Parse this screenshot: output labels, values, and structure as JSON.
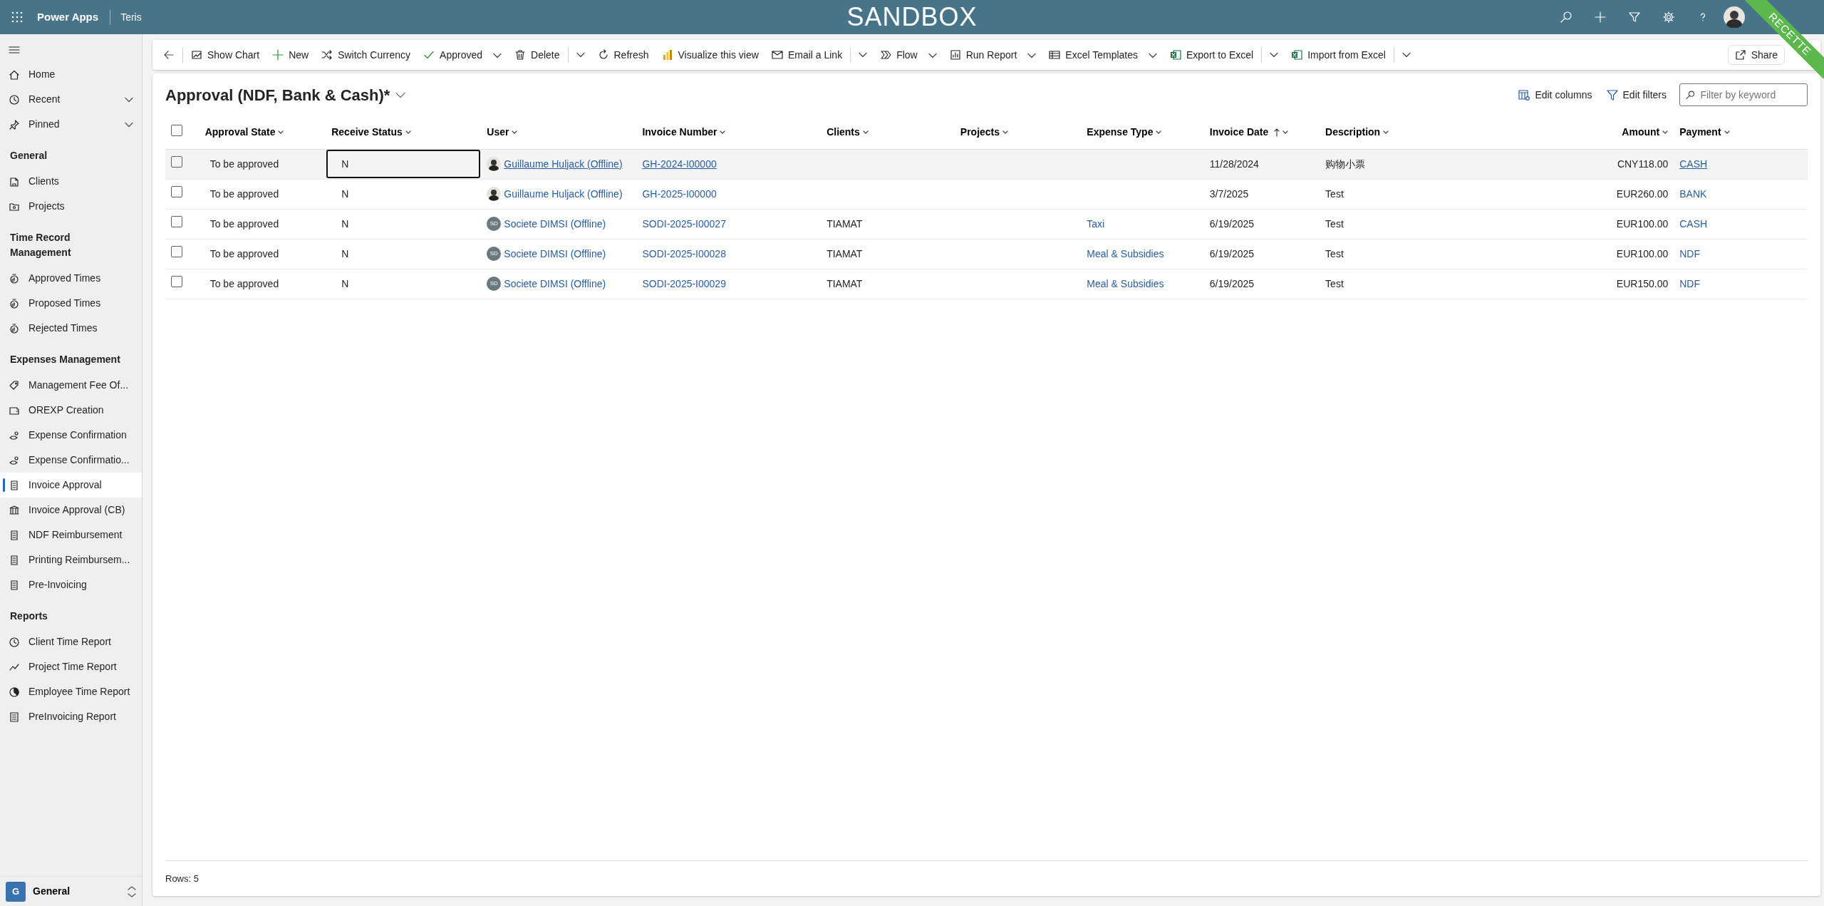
{
  "app_bar": {
    "app_name": "Power Apps",
    "environment": "Teris",
    "banner": "SANDBOX",
    "ribbon": "RECETTE"
  },
  "sidebar": {
    "top_items": [
      {
        "label": "Home",
        "expandable": false,
        "selected": false
      },
      {
        "label": "Recent",
        "expandable": true,
        "selected": false
      },
      {
        "label": "Pinned",
        "expandable": true,
        "selected": false
      }
    ],
    "groups": [
      {
        "heading": "General",
        "items": [
          {
            "label": "Clients",
            "selected": false
          },
          {
            "label": "Projects",
            "selected": false
          }
        ]
      },
      {
        "heading": "Time Record Management",
        "items": [
          {
            "label": "Approved Times",
            "selected": false
          },
          {
            "label": "Proposed Times",
            "selected": false
          },
          {
            "label": "Rejected Times",
            "selected": false
          }
        ]
      },
      {
        "heading": "Expenses Management",
        "items": [
          {
            "label": "Management Fee Of...",
            "selected": false
          },
          {
            "label": "OREXP Creation",
            "selected": false
          },
          {
            "label": "Expense Confirmation",
            "selected": false
          },
          {
            "label": "Expense Confirmatio...",
            "selected": false
          },
          {
            "label": "Invoice Approval",
            "selected": true
          },
          {
            "label": "Invoice Approval (CB)",
            "selected": false
          },
          {
            "label": "NDF Reimbursement",
            "selected": false
          },
          {
            "label": "Printing Reimbursem...",
            "selected": false
          },
          {
            "label": "Pre-Invoicing",
            "selected": false
          }
        ]
      },
      {
        "heading": "Reports",
        "items": [
          {
            "label": "Client Time Report",
            "selected": false
          },
          {
            "label": "Project Time Report",
            "selected": false
          },
          {
            "label": "Employee Time Report",
            "selected": false
          },
          {
            "label": "PreInvoicing Report",
            "selected": false
          }
        ]
      }
    ],
    "area_switcher": {
      "initial": "G",
      "label": "General"
    }
  },
  "command_bar": {
    "commands": [
      {
        "kind": "back"
      },
      {
        "kind": "button",
        "label": "Show Chart"
      },
      {
        "kind": "button",
        "label": "New"
      },
      {
        "kind": "button",
        "label": "Switch Currency"
      },
      {
        "kind": "menu",
        "label": "Approved"
      },
      {
        "kind": "split",
        "label": "Delete"
      },
      {
        "kind": "button",
        "label": "Refresh"
      },
      {
        "kind": "button",
        "label": "Visualize this view"
      },
      {
        "kind": "split",
        "label": "Email a Link"
      },
      {
        "kind": "menu",
        "label": "Flow"
      },
      {
        "kind": "menu",
        "label": "Run Report"
      },
      {
        "kind": "menu",
        "label": "Excel Templates"
      },
      {
        "kind": "split",
        "label": "Export to Excel"
      },
      {
        "kind": "split",
        "label": "Import from Excel"
      }
    ],
    "share": "Share"
  },
  "view": {
    "title": "Approval (NDF, Bank & Cash)*",
    "actions": [
      "Edit columns",
      "Edit filters"
    ],
    "filter_placeholder": "Filter by keyword"
  },
  "table": {
    "select_all": {
      "checked": false
    },
    "columns": [
      {
        "label": "Approval State",
        "sorted": false,
        "right_aligned": false
      },
      {
        "label": "Receive Status",
        "sorted": false,
        "right_aligned": false
      },
      {
        "label": "User",
        "sorted": false,
        "right_aligned": false
      },
      {
        "label": "Invoice Number",
        "sorted": false,
        "right_aligned": false
      },
      {
        "label": "Clients",
        "sorted": false,
        "right_aligned": false
      },
      {
        "label": "Projects",
        "sorted": false,
        "right_aligned": false
      },
      {
        "label": "Expense Type",
        "sorted": false,
        "right_aligned": false
      },
      {
        "label": "Invoice Date",
        "sorted": true,
        "right_aligned": false
      },
      {
        "label": "Description",
        "sorted": false,
        "right_aligned": false
      },
      {
        "label": "Amount",
        "sorted": false,
        "right_aligned": true
      },
      {
        "label": "Payment",
        "sorted": false,
        "right_aligned": false
      }
    ],
    "rows": [
      {
        "highlighted": true,
        "checked": false,
        "cells": [
          {
            "kind": "text",
            "text": "To be approved",
            "focused": false
          },
          {
            "kind": "text",
            "text": "N",
            "focused": true
          },
          {
            "kind": "user_photo",
            "text": "Guillaume Huljack (Offline)",
            "focused": false
          },
          {
            "kind": "link",
            "text": "GH-2024-I00000",
            "focused": false
          },
          {
            "kind": "empty",
            "focused": false
          },
          {
            "kind": "empty",
            "focused": false
          },
          {
            "kind": "empty",
            "focused": false
          },
          {
            "kind": "text",
            "text": "11/28/2024",
            "focused": false
          },
          {
            "kind": "text",
            "text": "购物小票",
            "focused": false
          },
          {
            "kind": "text",
            "text": "CNY118.00",
            "focused": false
          },
          {
            "kind": "link",
            "text": "CASH",
            "focused": false
          }
        ]
      },
      {
        "highlighted": false,
        "checked": false,
        "cells": [
          {
            "kind": "text",
            "text": "To be approved",
            "focused": false
          },
          {
            "kind": "text",
            "text": "N",
            "focused": false
          },
          {
            "kind": "user_photo",
            "text": "Guillaume Huljack (Offline)",
            "focused": false
          },
          {
            "kind": "link",
            "text": "GH-2025-I00000",
            "focused": false
          },
          {
            "kind": "empty",
            "focused": false
          },
          {
            "kind": "empty",
            "focused": false
          },
          {
            "kind": "empty",
            "focused": false
          },
          {
            "kind": "text",
            "text": "3/7/2025",
            "focused": false
          },
          {
            "kind": "text",
            "text": "Test",
            "focused": false
          },
          {
            "kind": "text",
            "text": "EUR260.00",
            "focused": false
          },
          {
            "kind": "link",
            "text": "BANK",
            "focused": false
          }
        ]
      },
      {
        "highlighted": false,
        "checked": false,
        "cells": [
          {
            "kind": "text",
            "text": "To be approved",
            "focused": false
          },
          {
            "kind": "text",
            "text": "N",
            "focused": false
          },
          {
            "kind": "user_initials",
            "text": "Societe DIMSI (Offline)",
            "initials": "SD",
            "focused": false
          },
          {
            "kind": "link",
            "text": "SODI-2025-I00027",
            "focused": false
          },
          {
            "kind": "text",
            "text": "TIAMAT",
            "focused": false
          },
          {
            "kind": "empty",
            "focused": false
          },
          {
            "kind": "link",
            "text": "Taxi",
            "focused": false
          },
          {
            "kind": "text",
            "text": "6/19/2025",
            "focused": false
          },
          {
            "kind": "text",
            "text": "Test",
            "focused": false
          },
          {
            "kind": "text",
            "text": "EUR100.00",
            "focused": false
          },
          {
            "kind": "link",
            "text": "CASH",
            "focused": false
          }
        ]
      },
      {
        "highlighted": false,
        "checked": false,
        "cells": [
          {
            "kind": "text",
            "text": "To be approved",
            "focused": false
          },
          {
            "kind": "text",
            "text": "N",
            "focused": false
          },
          {
            "kind": "user_initials",
            "text": "Societe DIMSI (Offline)",
            "initials": "SD",
            "focused": false
          },
          {
            "kind": "link",
            "text": "SODI-2025-I00028",
            "focused": false
          },
          {
            "kind": "text",
            "text": "TIAMAT",
            "focused": false
          },
          {
            "kind": "empty",
            "focused": false
          },
          {
            "kind": "link",
            "text": "Meal & Subsidies",
            "focused": false
          },
          {
            "kind": "text",
            "text": "6/19/2025",
            "focused": false
          },
          {
            "kind": "text",
            "text": "Test",
            "focused": false
          },
          {
            "kind": "text",
            "text": "EUR100.00",
            "focused": false
          },
          {
            "kind": "link",
            "text": "NDF",
            "focused": false
          }
        ]
      },
      {
        "highlighted": false,
        "checked": false,
        "cells": [
          {
            "kind": "text",
            "text": "To be approved",
            "focused": false
          },
          {
            "kind": "text",
            "text": "N",
            "focused": false
          },
          {
            "kind": "user_initials",
            "text": "Societe DIMSI (Offline)",
            "initials": "SD",
            "focused": false
          },
          {
            "kind": "link",
            "text": "SODI-2025-I00029",
            "focused": false
          },
          {
            "kind": "text",
            "text": "TIAMAT",
            "focused": false
          },
          {
            "kind": "empty",
            "focused": false
          },
          {
            "kind": "link",
            "text": "Meal & Subsidies",
            "focused": false
          },
          {
            "kind": "text",
            "text": "6/19/2025",
            "focused": false
          },
          {
            "kind": "text",
            "text": "Test",
            "focused": false
          },
          {
            "kind": "text",
            "text": "EUR150.00",
            "focused": false
          },
          {
            "kind": "link",
            "text": "NDF",
            "focused": false
          }
        ]
      }
    ]
  },
  "footer": {
    "row_count": "Rows: 5"
  }
}
